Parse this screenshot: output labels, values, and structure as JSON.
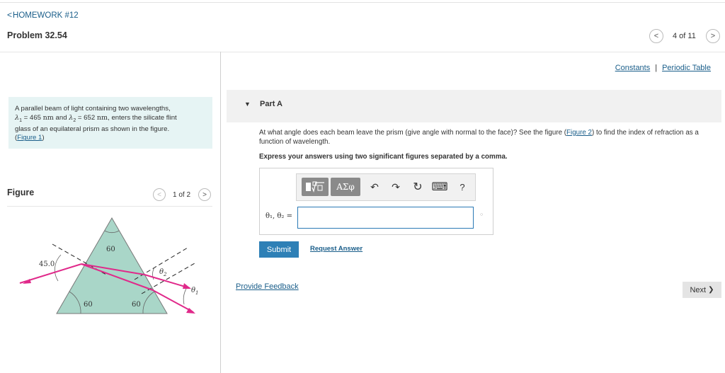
{
  "header": {
    "back_chevron": "<",
    "back_label": "HOMEWORK #12",
    "problem_title": "Problem 32.54",
    "pager_text": "4 of 11",
    "prev_glyph": "<",
    "next_glyph": ">"
  },
  "links": {
    "constants": "Constants",
    "separator": "|",
    "periodic_table": "Periodic Table"
  },
  "problem": {
    "line1": "A parallel beam of light containing two wavelengths,",
    "lambda1": "λ",
    "sub1": "1",
    "eq1": " = 465 ",
    "unit1": "nm",
    "and": " and ",
    "lambda2": "λ",
    "sub2": "2",
    "eq2": " = 652 ",
    "unit2": "nm",
    "line2_rest": ", enters the silicate flint",
    "line3": "glass of an equilateral prism as shown in the figure.",
    "figure_link": "Figure 1",
    "paren_open": "(",
    "paren_close": ")"
  },
  "figure": {
    "label": "Figure",
    "pager_text": "1 of 2",
    "prev_glyph": "<",
    "next_glyph": ">",
    "angle_top": "60",
    "angle_left": "60",
    "angle_right": "60",
    "incidence_angle": "45.0",
    "theta2": "θ",
    "theta2_sub": "2",
    "theta1": "θ",
    "theta1_sub": "1",
    "colors": {
      "prism": "#a9d6c8",
      "beam": "#e0298a",
      "outline": "#555555"
    }
  },
  "partA": {
    "label": "Part A",
    "toggle_glyph": "▼",
    "question_pre": "At what angle does each beam leave the prism (give angle with normal to the face)? See the figure (",
    "question_link": "Figure 2",
    "question_post": ") to find the index of refraction as a function of wavelength.",
    "instruction": "Express your answers using two significant figures separated by a comma.",
    "toolbar": {
      "templates_icon": "templates-icon",
      "greek_label": "ΑΣφ",
      "undo": "↶",
      "redo": "↷",
      "reset": "↻",
      "keyboard": "⌨",
      "help": "?"
    },
    "answer_label": "θ₁, θ₂ =",
    "answer_value": "",
    "submit": "Submit",
    "request_answer": "Request Answer"
  },
  "footer": {
    "feedback": "Provide Feedback",
    "next": "Next",
    "next_glyph": "❯"
  }
}
